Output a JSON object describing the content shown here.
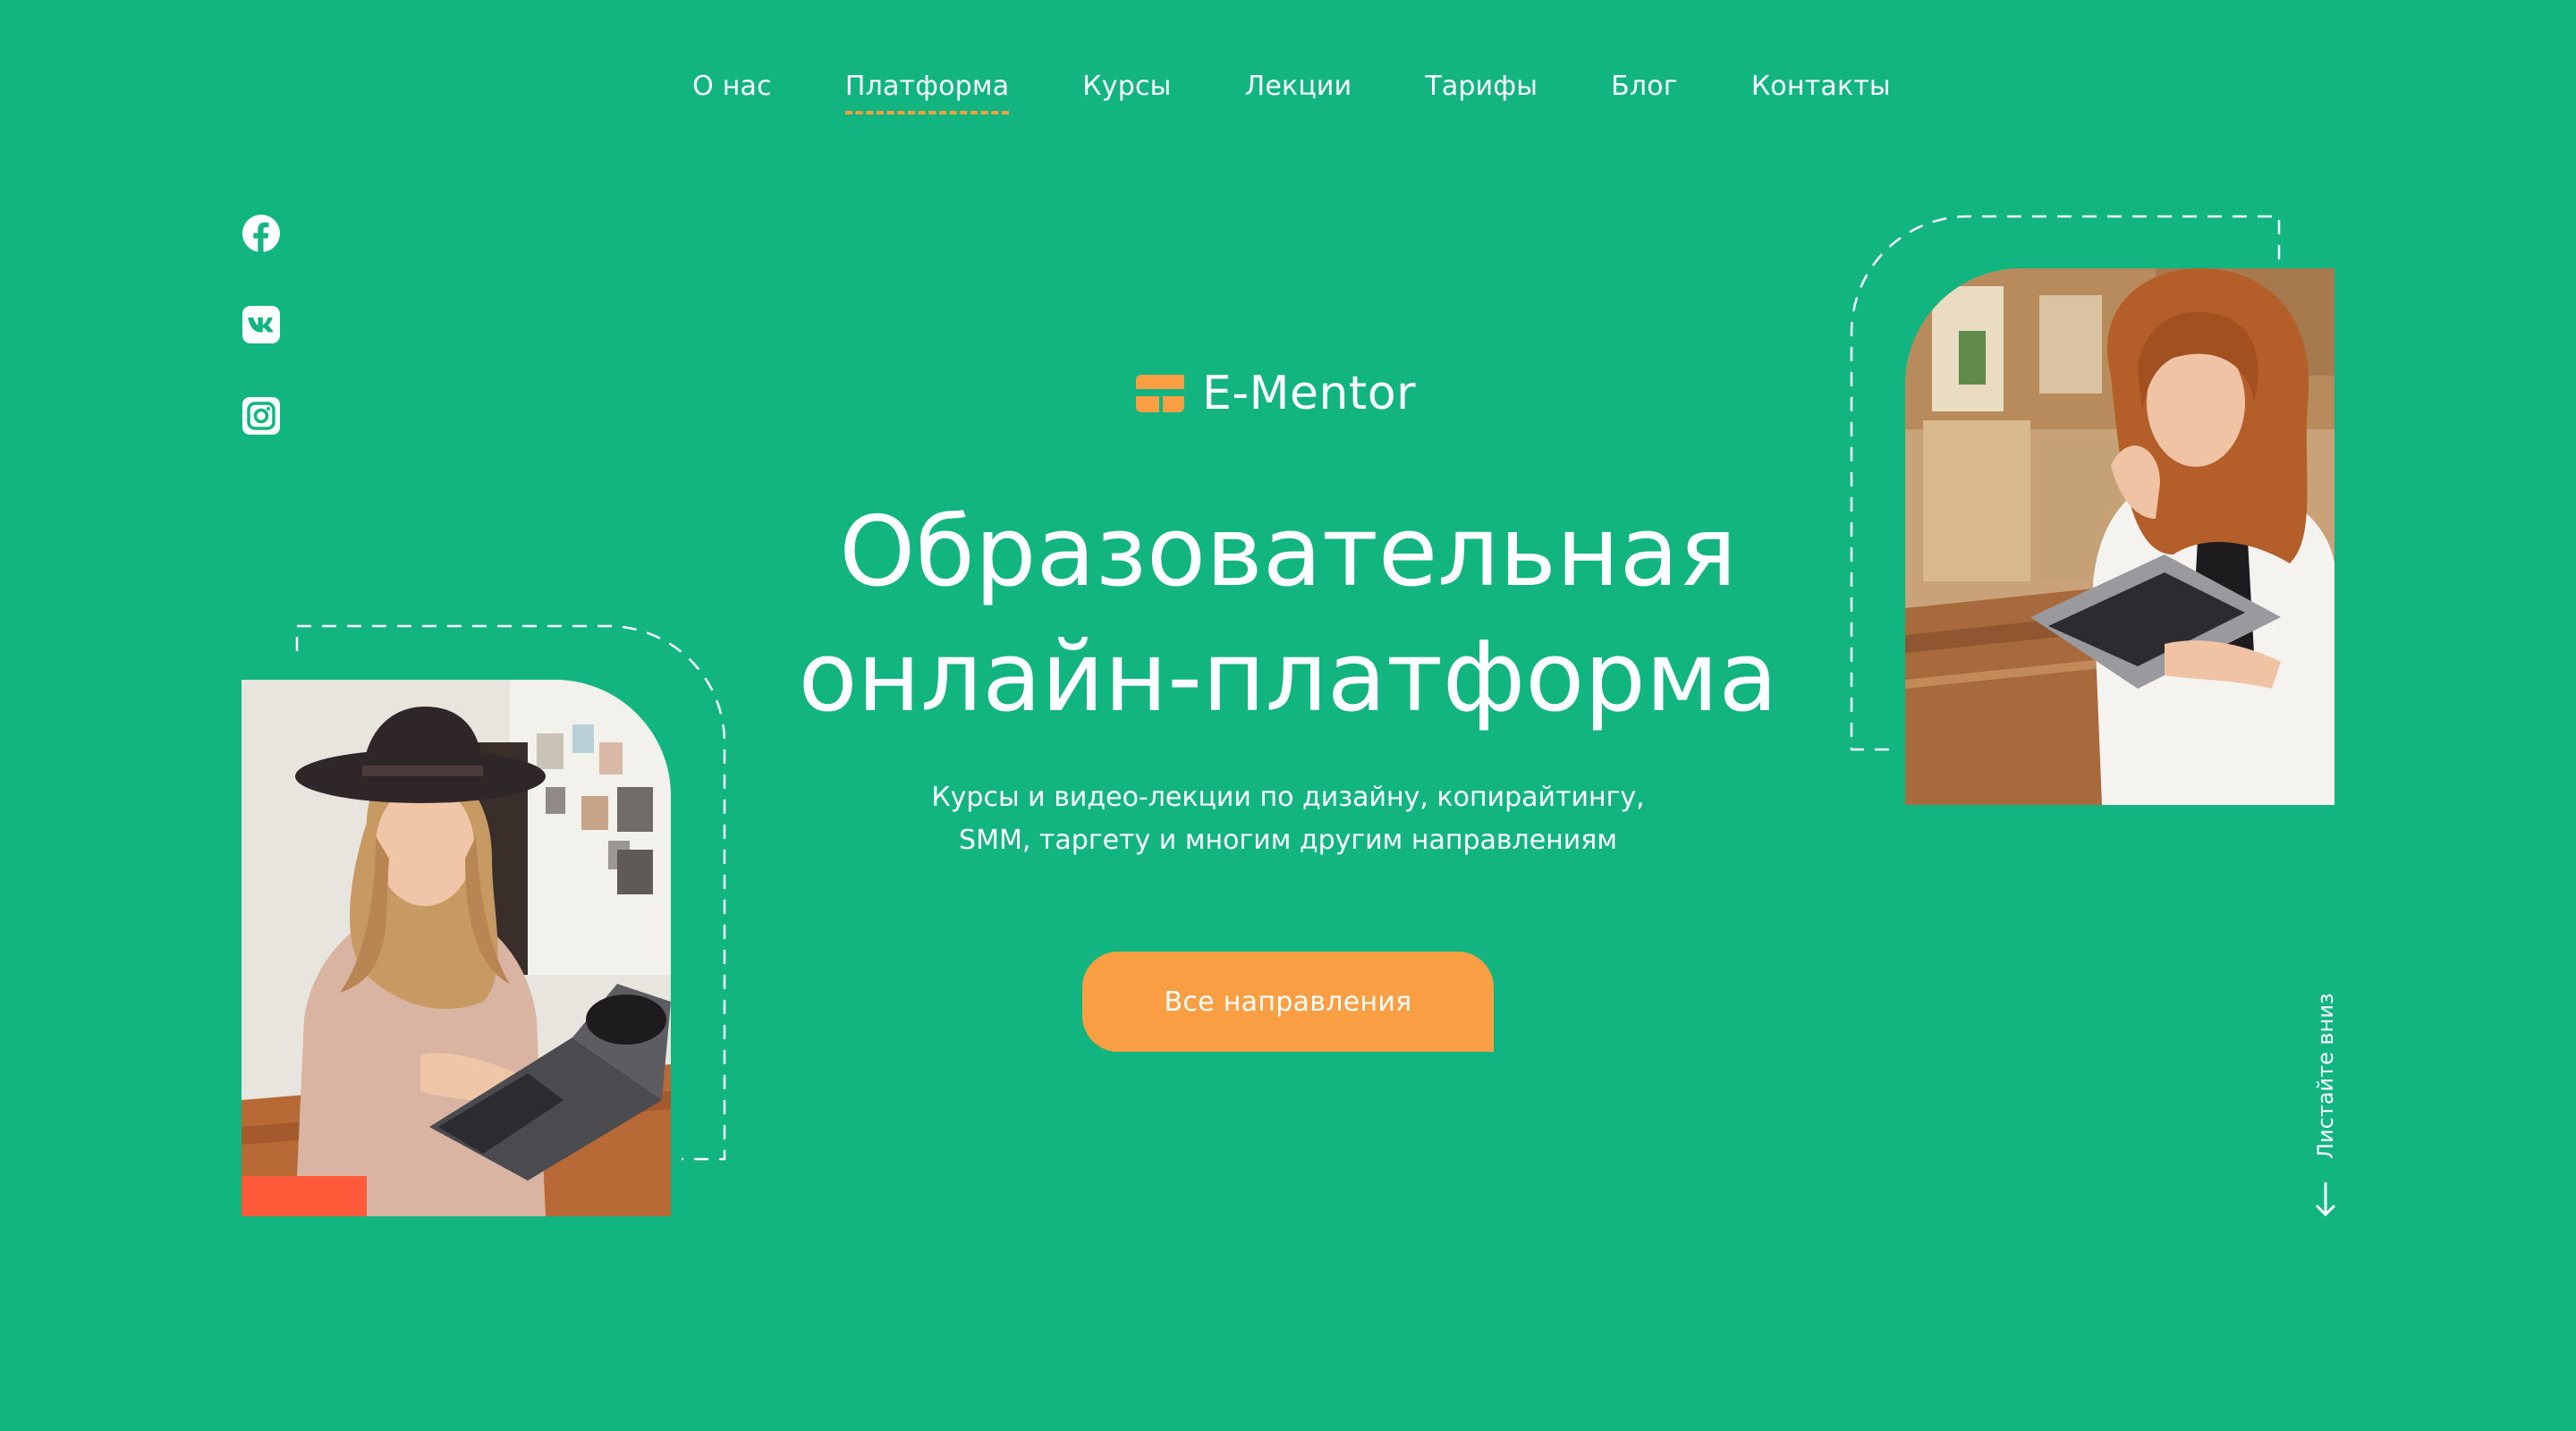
{
  "nav": {
    "items": [
      {
        "label": "О нас"
      },
      {
        "label": "Платформа"
      },
      {
        "label": "Курсы"
      },
      {
        "label": "Лекции"
      },
      {
        "label": "Тарифы"
      },
      {
        "label": "Блог"
      },
      {
        "label": "Контакты"
      }
    ],
    "active_index": 1
  },
  "social": [
    "facebook-icon",
    "vk-icon",
    "instagram-icon"
  ],
  "brand": {
    "name": "E-Mentor",
    "logo_icon": "e-mentor-logo-icon"
  },
  "hero": {
    "title_line1": "Образовательная",
    "title_line2": "онлайн-платформа",
    "subtitle_line1": "Курсы и видео-лекции по дизайну, копирайтингу,",
    "subtitle_line2": "SMM, таргету и многим другим направлениям",
    "cta_label": "Все направления"
  },
  "scroll_hint": {
    "label": "Листайте вниз",
    "icon": "arrow-down-icon"
  },
  "colors": {
    "background": "#12b57f",
    "accent": "#fa9e44",
    "text": "#ffffff"
  }
}
